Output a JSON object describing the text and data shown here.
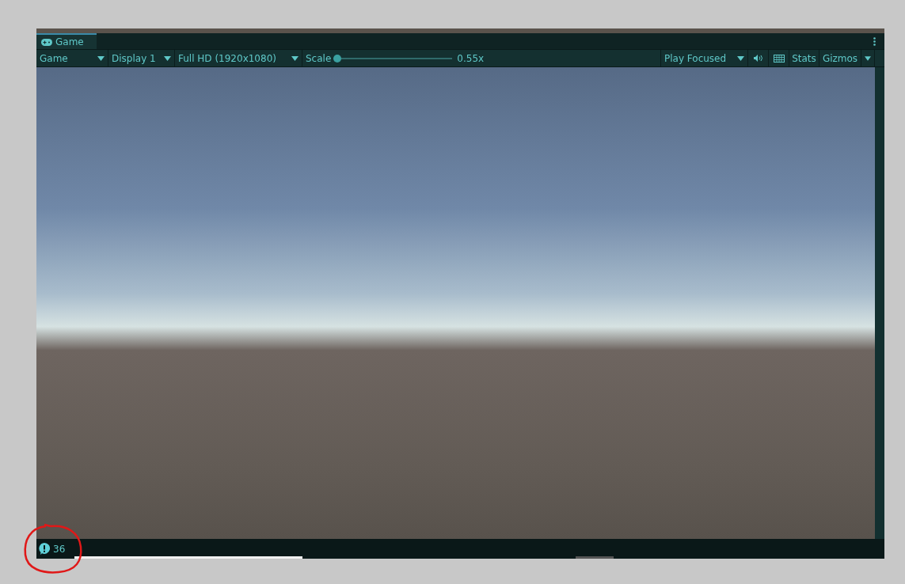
{
  "tab": {
    "label": "Game",
    "selected": true
  },
  "toolbar": {
    "view_mode": "Game",
    "display": "Display 1",
    "resolution": "Full HD (1920x1080)",
    "scale": {
      "label": "Scale",
      "level": 0,
      "reading": "0.55x"
    },
    "play_mode": "Play Focused",
    "buttons": [
      "Stats",
      "Gizmos"
    ]
  },
  "status_bar": {
    "count": "36"
  }
}
